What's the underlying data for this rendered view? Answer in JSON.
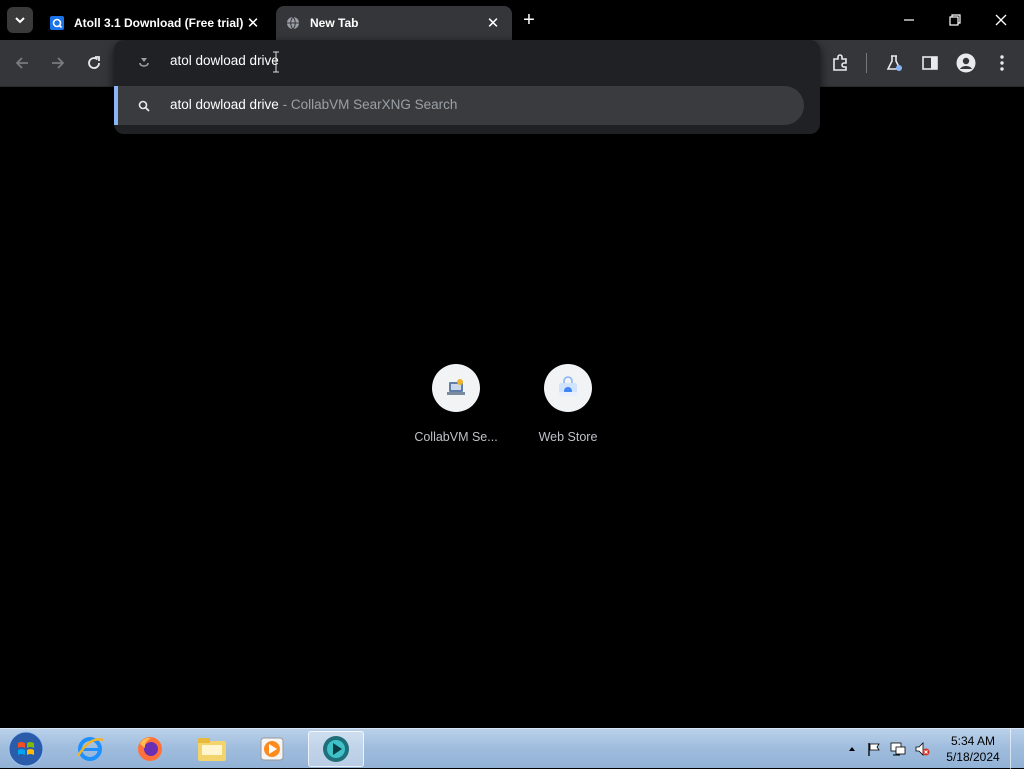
{
  "tabs": [
    {
      "title": "Atoll 3.1 Download (Free trial)",
      "close": "✕",
      "favicon": "q-logo-icon"
    },
    {
      "title": "New Tab",
      "close": "✕",
      "favicon": "globe-icon"
    }
  ],
  "window": {
    "new_tab": "+",
    "minimize": "—",
    "maximize": "❐",
    "close": "✕"
  },
  "omnibox": {
    "input_value": "atol dowload drive",
    "suggestions": [
      {
        "query": "atol dowload drive",
        "separator": " - ",
        "source": "CollabVM SearXNG Search",
        "icon": "search-icon"
      }
    ]
  },
  "shortcuts": [
    {
      "label": "CollabVM Se...",
      "icon": "collabvm-icon"
    },
    {
      "label": "Web Store",
      "icon": "web-store-icon"
    }
  ],
  "taskbar": {
    "apps": [
      "internet-explorer-icon",
      "firefox-icon",
      "file-explorer-icon",
      "media-player-icon",
      "active-app-icon"
    ],
    "clock": {
      "time": "5:34 AM",
      "date": "5/18/2024"
    }
  },
  "colors": {
    "accent": "#8ab4f8",
    "toolbar": "#35363a",
    "popup": "#202124",
    "taskbar": "#9fbcdd"
  }
}
